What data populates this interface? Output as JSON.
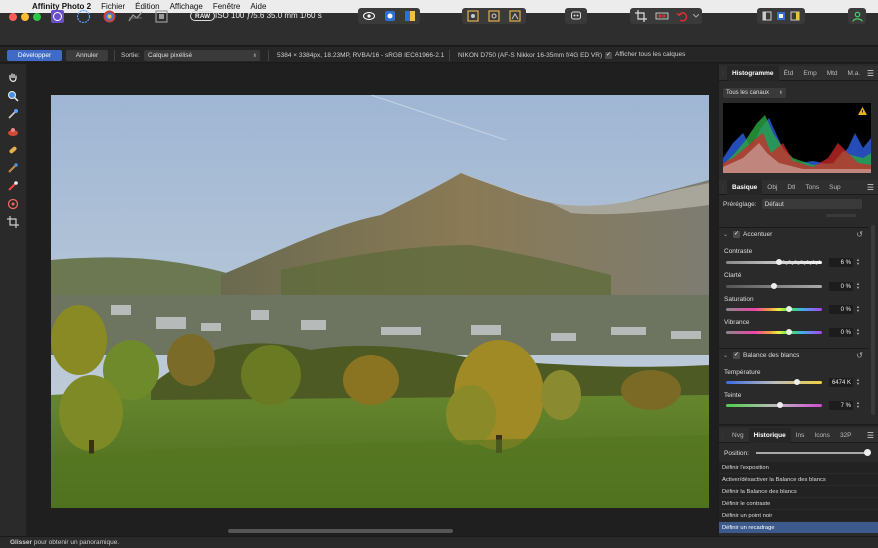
{
  "menubar": {
    "app_name": "Affinity Photo 2",
    "items": [
      "Fichier",
      "Édition",
      "Affichage",
      "Fenêtre",
      "Aide"
    ]
  },
  "toolbar": {
    "raw_badge": "RAW",
    "exif_text": "ISO 100 ƒ/5.6 35.0 mm 1/60 s"
  },
  "context_bar": {
    "develop_label": "Développer",
    "cancel_label": "Annuler",
    "output_label": "Sortie:",
    "output_value": "Calque pixélisé",
    "image_info": "5384 × 3384px, 18.23MP, RVBA/16 - sRGB IEC61966-2.1",
    "camera_info": "NIKON D750 (AF-S Nikkor 16-35mm f/4G ED VR)",
    "show_all_layers_label": "Afficher tous les calques"
  },
  "histogram_panel": {
    "tabs": [
      "Histogramme",
      "Étd",
      "Emp",
      "Mtd",
      "M.a."
    ],
    "channel_select": "Tous les canaux"
  },
  "develop_panel": {
    "tabs": [
      "Basique",
      "Obj",
      "Dtl",
      "Tons",
      "Sup"
    ],
    "preset_label": "Préréglage:",
    "preset_value": "Défaut",
    "sections": {
      "sharpen": {
        "title": "Accentuer",
        "sliders": [
          {
            "label": "Contraste",
            "value": "6 %",
            "fraction": 0.55
          },
          {
            "label": "Clarté",
            "value": "0 %",
            "fraction": 0.5
          },
          {
            "label": "Saturation",
            "value": "0 %",
            "fraction": 0.66
          },
          {
            "label": "Vibrance",
            "value": "0 %",
            "fraction": 0.66
          }
        ]
      },
      "white_balance": {
        "title": "Balance des blancs",
        "sliders": [
          {
            "label": "Température",
            "value": "6474 K",
            "fraction": 0.74
          },
          {
            "label": "Teinte",
            "value": "7 %",
            "fraction": 0.56
          }
        ]
      }
    }
  },
  "history_panel": {
    "tabs": [
      "Nvg",
      "Historique",
      "Ins",
      "Icons",
      "32P"
    ],
    "position_label": "Position:",
    "position_fraction": 1.0,
    "items": [
      "Définir l'exposition",
      "Activer/désactiver la Balance des blancs",
      "Définir la Balance des blancs",
      "Définir le contraste",
      "Définir un point noir",
      "Définir un recadrage"
    ],
    "selected_index": 5
  },
  "status_bar": {
    "bold": "Glisser",
    "text": " pour obtenir un panoramique."
  },
  "colors": {
    "accent": "#3f6bc7",
    "panel_bg": "#2a2a2a",
    "canvas_bg": "#1f1f1f",
    "selected_row": "#3d5a8c"
  }
}
